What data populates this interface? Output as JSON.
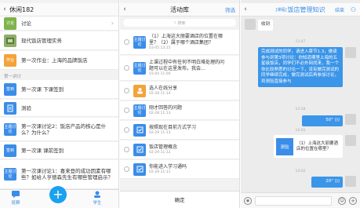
{
  "left": {
    "title": "休闲182",
    "rows": [
      {
        "icon": "讨论",
        "label": "讨论"
      },
      {
        "icon": "",
        "label": "现代饭店管理实务"
      },
      {
        "icon": "作业",
        "label": "第一次作业：上海的品牌饭店"
      },
      {
        "icon": "签到",
        "label": "第一次课 下课签到"
      },
      {
        "icon": "",
        "label": "测验"
      },
      {
        "icon": "主题讨论",
        "label": "第一次课讨论2：饭店产品的核心是什么？为什么？"
      },
      {
        "icon": "签到",
        "label": "第一次课 课前签到"
      },
      {
        "icon": "主题讨论",
        "label": "第一次课讨论1：喜来登的成功因素有哪些？如给人亨德森先生有哪些管理启示？"
      }
    ],
    "section": "第一讲讨",
    "tabs": {
      "left": "班群",
      "right": "学生"
    },
    "fab": "+"
  },
  "middle": {
    "title": "活动库",
    "action": "筛选",
    "search": "搜索",
    "items": [
      {
        "icon": "主题讨论",
        "title": "（1）上海这大丽要酒店的位置在哪里？（2）属于哪个酒店集团？",
        "time": "03-05 13:15"
      },
      {
        "icon": "主题讨论",
        "title": "上课过程中有任何不明白难处理的问题可以在这里发布，我会...",
        "time": "03-04 11:00"
      },
      {
        "icon": "",
        "title": "选人在线分享",
        "time": "02-28 11:14"
      },
      {
        "icon": "主题讨论",
        "title": "刚才回答的问题",
        "time": "02-28 11:13"
      },
      {
        "icon": "",
        "title": "按照现在目前方式学习",
        "time": "02-29 11:13"
      },
      {
        "icon": "",
        "title": "饭店管理概念",
        "time": "02-29 11:12"
      },
      {
        "icon": "",
        "title": "你能进入学习通吗",
        "time": "02-29 11:11"
      }
    ],
    "confirm": "确定"
  },
  "right": {
    "tag": "[课程]",
    "title": "饭店管理知识",
    "action": "结束",
    "messages": [
      {
        "text": "收到"
      },
      {
        "time": "13:47"
      },
      {
        "text": "完成测试的同学，请进入章节1.3，做读参与到第3项讨论：你知道哪里上海的五星级饭店，同学们不必外网找来，我一个你比较熟悉的讨论一下，没有做完测试的同学继续完成，做完测试后再参加讨论，到测验直接参与"
      },
      {
        "time": "13:58"
      },
      {
        "text": "50\""
      },
      {
        "time": "14:01"
      },
      {
        "title": "测验",
        "text": "（1）上海这大丽要酒店的位置在哪里？"
      },
      {
        "time": "14:02"
      },
      {
        "text": "20\""
      }
    ]
  },
  "colors": {
    "accent": "#3b8de8",
    "fab": "#1aa1ef",
    "bubble": "#3b95e8"
  }
}
